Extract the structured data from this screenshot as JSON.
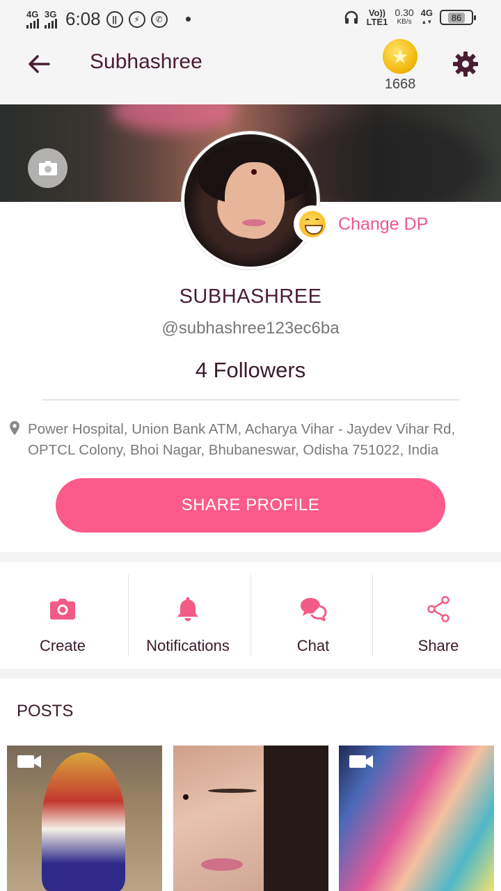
{
  "status_bar": {
    "network_left_1": "4G",
    "network_left_2": "3G",
    "time": "6:08",
    "volte": "Vo))",
    "lte": "LTE1",
    "speed_value": "0.30",
    "speed_unit": "KB/s",
    "network_right": "4G",
    "battery": "86"
  },
  "app_bar": {
    "title": "Subhashree",
    "coin_count": "1668"
  },
  "profile": {
    "change_dp_label": "Change DP",
    "name": "SUBHASHREE",
    "handle": "@subhashree123ec6ba",
    "followers": "4 Followers",
    "location": "Power Hospital, Union Bank ATM, Acharya Vihar - Jaydev Vihar Rd, OPTCL Colony, Bhoi Nagar, Bhubaneswar, Odisha 751022, India",
    "share_label": "SHARE PROFILE"
  },
  "actions": [
    {
      "label": "Create",
      "icon": "camera-icon"
    },
    {
      "label": "Notifications",
      "icon": "bell-icon"
    },
    {
      "label": "Chat",
      "icon": "chat-bubbles-icon"
    },
    {
      "label": "Share",
      "icon": "share-icon"
    }
  ],
  "posts": {
    "title": "POSTS"
  },
  "colors": {
    "accent": "#fb5a8a",
    "title_text": "#4a1c33",
    "icon_accent": "#f25c84"
  }
}
